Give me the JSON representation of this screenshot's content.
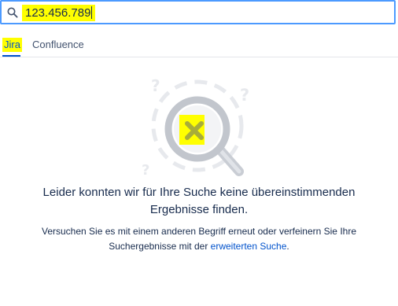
{
  "search": {
    "value": "123.456.789",
    "icon": "search-icon"
  },
  "tabs": [
    {
      "label": "Jira",
      "active": true
    },
    {
      "label": "Confluence",
      "active": false
    }
  ],
  "empty_state": {
    "illustration_icon": "no-results-magnifier-icon",
    "title_line1": "Leider konnten wir für Ihre Suche keine übereinstimmenden",
    "title_line2": "Ergebnisse finden.",
    "desc_line1": "Versuchen Sie es mit einem anderen Begriff erneut oder verfeinern Sie Ihre",
    "desc_line2_prefix": "Suchergebnisse mit der ",
    "advanced_link": "erweiterten Suche",
    "desc_line2_suffix": "."
  },
  "colors": {
    "accent": "#0052cc",
    "focus_border": "#4c9aff",
    "highlight": "#ffff00",
    "text": "#172b4d"
  }
}
